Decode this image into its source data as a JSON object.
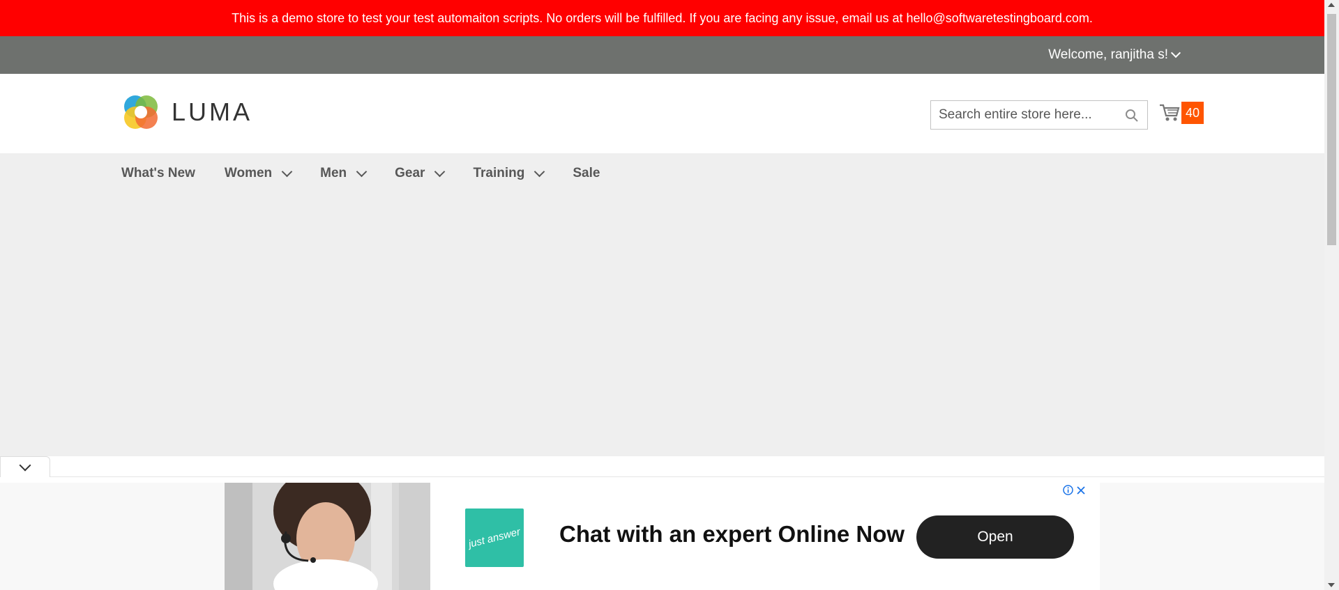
{
  "banner": {
    "text": "This is a demo store to test your test automaiton scripts. No orders will be fulfilled. If you are facing any issue, email us at hello@softwaretestingboard.com."
  },
  "top_bar": {
    "welcome": "Welcome, ranjitha s!"
  },
  "header": {
    "logo_text": "LUMA",
    "search_placeholder": "Search entire store here...",
    "cart_count": "40"
  },
  "nav": {
    "items": [
      {
        "label": "What's New",
        "has_dropdown": false
      },
      {
        "label": "Women",
        "has_dropdown": true
      },
      {
        "label": "Men",
        "has_dropdown": true
      },
      {
        "label": "Gear",
        "has_dropdown": true
      },
      {
        "label": "Training",
        "has_dropdown": true
      },
      {
        "label": "Sale",
        "has_dropdown": false
      }
    ]
  },
  "ad": {
    "brand_text": "just answer",
    "headline": "Chat with an expert Online Now",
    "button_label": "Open"
  },
  "colors": {
    "banner": "#ff0000",
    "top_bar": "#6e716e",
    "cart_badge": "#ff5501",
    "main_bg": "#efefef",
    "ad_brand": "#2fbfa6"
  }
}
